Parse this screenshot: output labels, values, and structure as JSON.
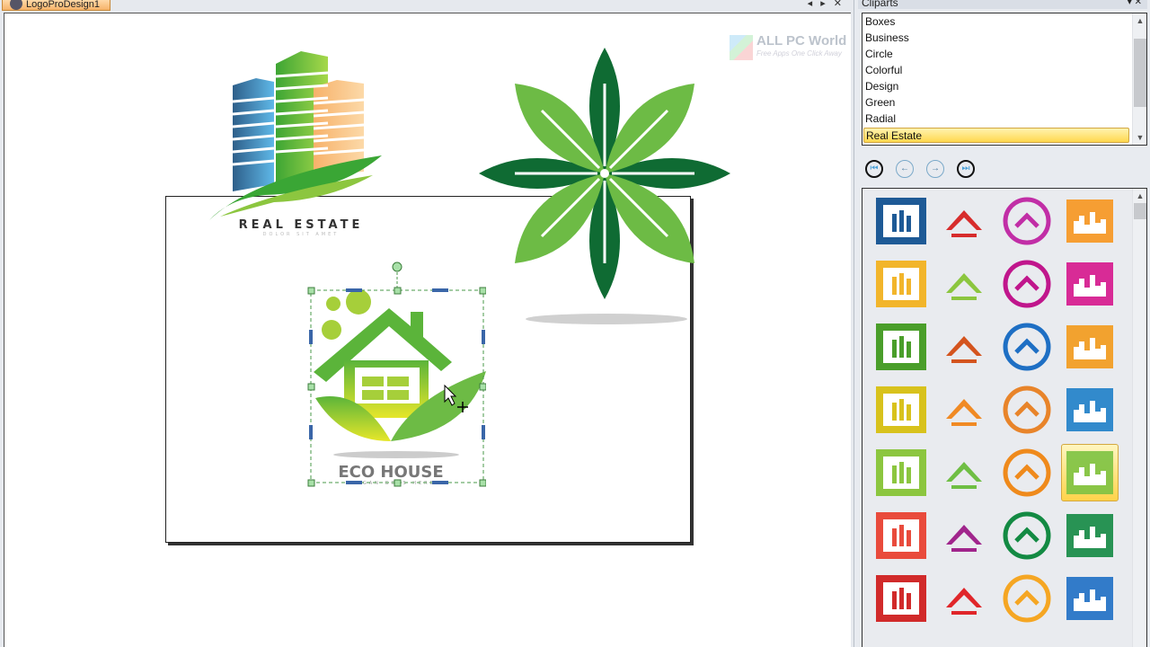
{
  "document": {
    "tab_title": "LogoProDesign1",
    "tab_controls": [
      "◂",
      "▸",
      "✕"
    ]
  },
  "canvas": {
    "logos": [
      {
        "name": "real-estate-buildings",
        "title": "REAL ESTATE",
        "subtitle": "DOLOR SIT AMET"
      },
      {
        "name": "green-leaf-flower"
      },
      {
        "name": "eco-house",
        "title": "ECO HOUSE",
        "subtitle": "SLOGAN GOES HERE",
        "selected": true
      }
    ],
    "watermark": {
      "title": "ALL PC World",
      "subtitle": "Free Apps One Click Away"
    }
  },
  "cliparts_panel": {
    "title": "Cliparts",
    "header_controls": [
      "▾",
      "✕"
    ],
    "categories": [
      "Boxes",
      "Business",
      "Circle",
      "Colorful",
      "Design",
      "Green",
      "Radial",
      "Real Estate"
    ],
    "selected_category": "Real Estate",
    "nav": {
      "first": "first-page-icon",
      "prev": "previous-page-icon",
      "next": "next-page-icon",
      "last": "last-page-icon"
    },
    "thumbnails": [
      {
        "label": "blue-buildings-frame",
        "color": "#1e5a96"
      },
      {
        "label": "red-roof-real-estate",
        "color": "#d72c2c"
      },
      {
        "label": "colorful-house-square",
        "color": "#c12ea6"
      },
      {
        "label": "orange-skyline-company",
        "color": "#f7961e"
      },
      {
        "label": "yellow-houses",
        "color": "#f2b52b"
      },
      {
        "label": "colorful-buildings-wave",
        "color": "#8cc63f"
      },
      {
        "label": "pixel-building-real-estate",
        "color": "#c0168c"
      },
      {
        "label": "magenta-pixel-building",
        "color": "#d6168c"
      },
      {
        "label": "green-circle-roof",
        "color": "#4a9e2a"
      },
      {
        "label": "orange-bars",
        "color": "#d4541e"
      },
      {
        "label": "blue-circle-house",
        "color": "#1e6fc4"
      },
      {
        "label": "orange-house-real-estate",
        "color": "#f39a1a"
      },
      {
        "label": "yellow-square-house",
        "color": "#d8c21c"
      },
      {
        "label": "orange-house-outline",
        "color": "#f08a24"
      },
      {
        "label": "roof-wave-real-estate",
        "color": "#e8842a"
      },
      {
        "label": "blue-frame-buildings",
        "color": "#1e80c8"
      },
      {
        "label": "green-swoosh",
        "color": "#8cc63f"
      },
      {
        "label": "buildings-real-estate",
        "color": "#6fbe44"
      },
      {
        "label": "orange-circle-bars",
        "color": "#ef8a1c"
      },
      {
        "label": "eco-house",
        "color": "#7dc242",
        "selected": true
      },
      {
        "label": "rainbow-fence-company",
        "color": "#e94b3c"
      },
      {
        "label": "magenta-buildings-company",
        "color": "#a0258c"
      },
      {
        "label": "green-box-buildings",
        "color": "#138a43"
      },
      {
        "label": "green-buildings",
        "color": "#138a43"
      },
      {
        "label": "red-roof-white",
        "color": "#d12a2a"
      },
      {
        "label": "red-box-chevron",
        "color": "#e0262a"
      },
      {
        "label": "orange-skyline",
        "color": "#f5a623"
      },
      {
        "label": "colorful-company",
        "color": "#1e6fc4"
      }
    ]
  }
}
